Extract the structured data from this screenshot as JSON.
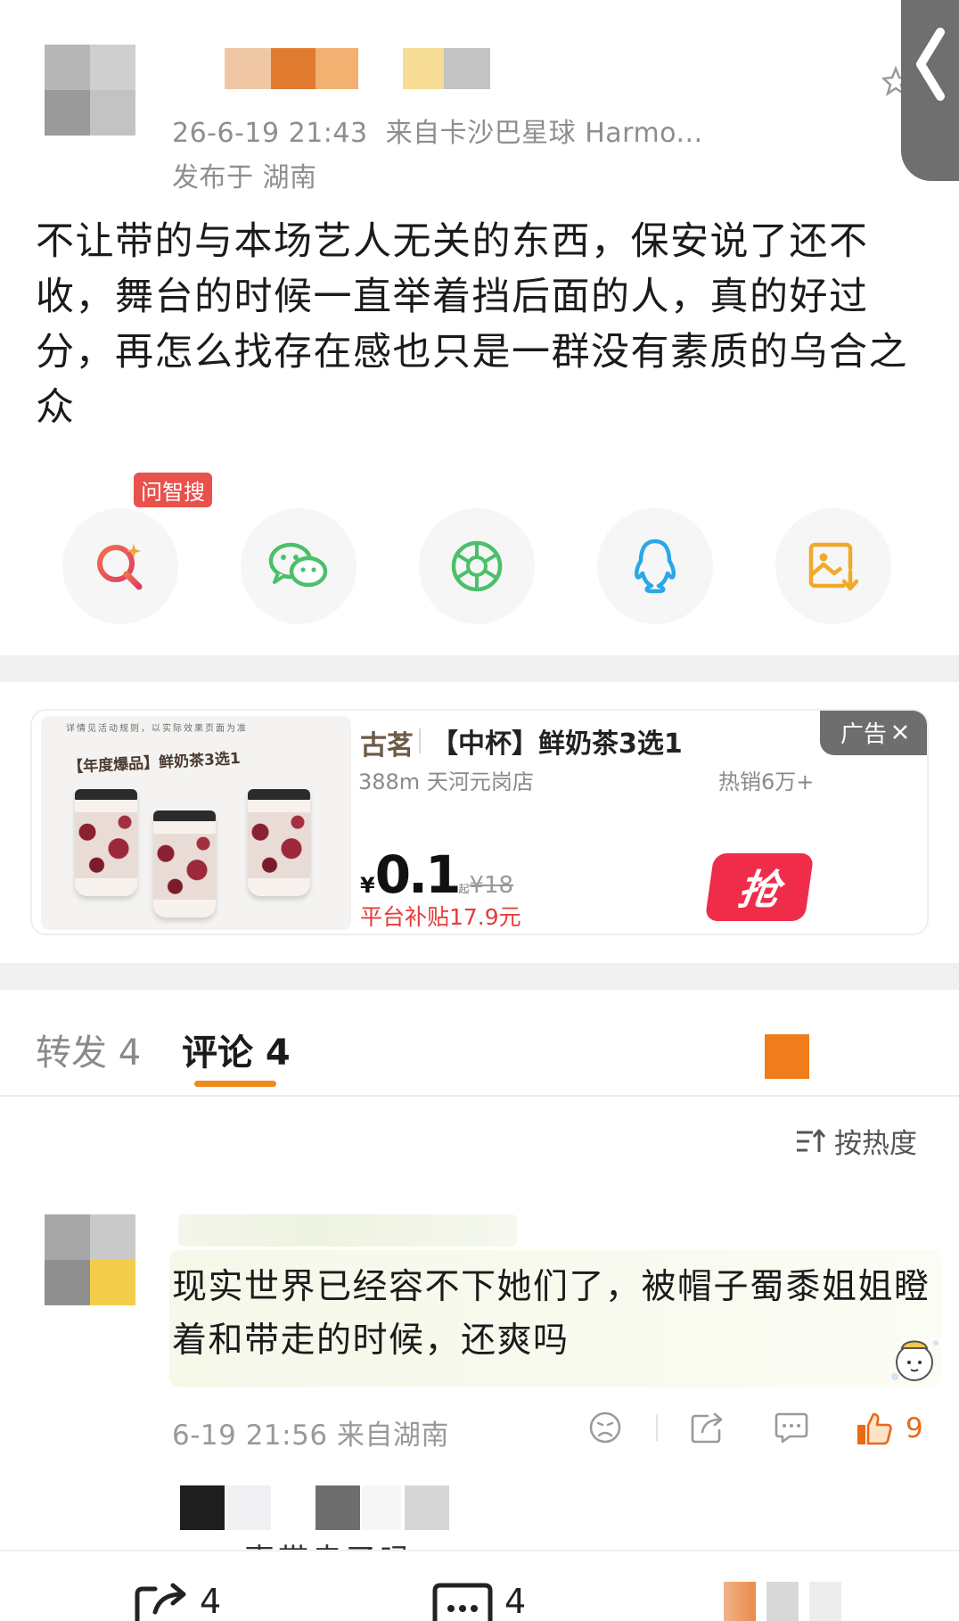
{
  "post": {
    "timestamp": "26-6-19 21:43",
    "source": "来自卡沙巴星球 Harmo...",
    "location": "发布于 湖南",
    "text": "不让带的与本场艺人无关的东西，保安说了还不收，舞台的时候一直举着挡后面的人，真的好过分，再怎么找存在感也只是一群没有素质的乌合之众"
  },
  "share": {
    "ai_badge": "问智搜",
    "items": [
      {
        "name": "search-ai-icon"
      },
      {
        "name": "wechat-icon"
      },
      {
        "name": "moments-icon"
      },
      {
        "name": "qq-icon"
      },
      {
        "name": "save-image-icon"
      }
    ]
  },
  "ad": {
    "tag": "广告",
    "image_header": "详情见活动规则，以实际效果页面为准",
    "image_title": "【年度爆品】鲜奶茶3选1",
    "brand": "古茗",
    "title": "【中杯】鲜奶茶3选1",
    "distance_store": "388m 天河元岗店",
    "hot_sales": "热销6万+",
    "currency": "¥",
    "price": "0.1",
    "price_qi": "起",
    "original_price": "¥18",
    "subsidy": "平台补贴17.9元",
    "grab": "抢"
  },
  "tabs": {
    "repost": "转发 4",
    "comment": "评论 4"
  },
  "sort": {
    "label": "按热度"
  },
  "comment": {
    "text": "现实世界已经容不下她们了，被帽子蜀黍姐姐瞪着和带走的时候，还爽吗",
    "meta": "6-19 21:56 来自湖南",
    "likes": "9"
  },
  "reply_preview": {
    "partial_text": "声带走了吗"
  },
  "bottom_bar": {
    "repost_count": "4",
    "comment_count": "4"
  },
  "colors": {
    "accent": "#f08a1c",
    "like": "#e86a17",
    "ad_red": "#ef2d4b"
  }
}
